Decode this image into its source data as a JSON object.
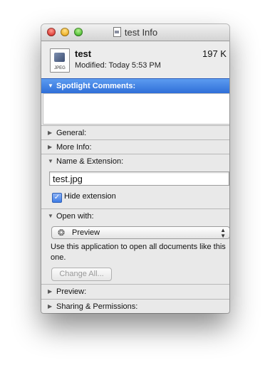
{
  "window": {
    "title": "test Info",
    "title_icon": "document-icon"
  },
  "file": {
    "name": "test",
    "size": "197 K",
    "modified": "Modified: Today 5:53 PM",
    "icon_label": "JPEG",
    "icon": "jpeg-document-icon"
  },
  "sections": {
    "spotlight": "Spotlight Comments:",
    "general": "General:",
    "more_info": "More Info:",
    "name_extension": "Name & Extension:",
    "open_with": "Open with:",
    "preview": "Preview:",
    "sharing": "Sharing & Permissions:"
  },
  "name_extension": {
    "filename": "test.jpg",
    "hide_extension_label": "Hide extension",
    "hide_extension_checked": true
  },
  "open_with": {
    "app": "Preview",
    "app_icon": "preview-app-icon",
    "description": "Use this application to open all documents like this one.",
    "change_all_label": "Change All..."
  },
  "colors": {
    "selection_blue": "#2f6fd8",
    "close": "#e0443e",
    "minimize": "#f0b32a",
    "zoom": "#56c23a"
  }
}
